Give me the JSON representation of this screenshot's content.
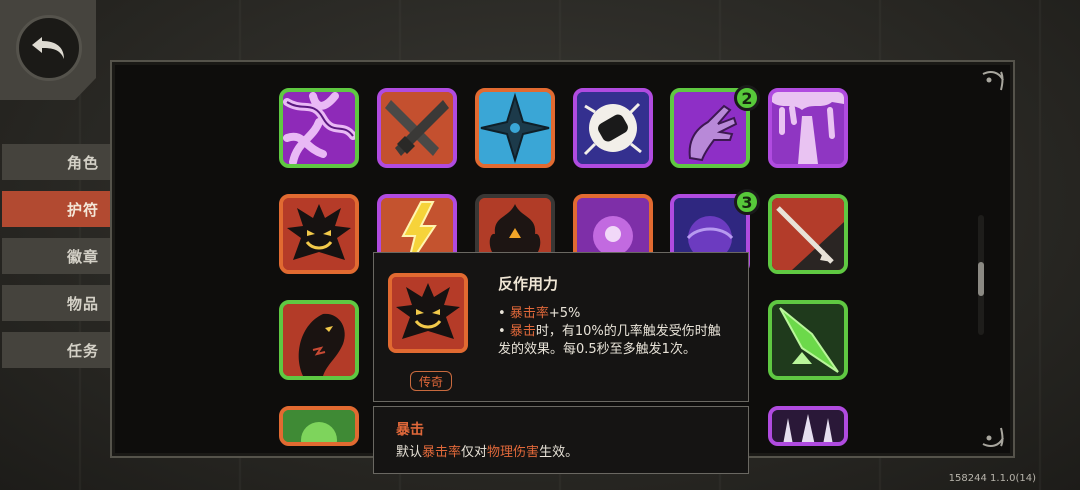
{
  "tabs": [
    {
      "label": "角色",
      "active": false
    },
    {
      "label": "护符",
      "active": true
    },
    {
      "label": "徽章",
      "active": false
    },
    {
      "label": "物品",
      "active": false
    },
    {
      "label": "任务",
      "active": false
    }
  ],
  "badges": {
    "row1": "2",
    "row2": "3"
  },
  "tooltip_main": {
    "title": "反作用力",
    "line1_prefix": "• ",
    "line1_hl": "暴击率",
    "line1_rest": "+5%",
    "line2_prefix": "• ",
    "line2_hl": "暴击",
    "line2_rest": "时，有10%的几率触发受伤时触发的效果。每0.5秒至多触发1次。",
    "rarity": "传奇"
  },
  "tooltip_sub": {
    "title": "暴击",
    "text_a": "默认",
    "text_hl1": "暴击率",
    "text_b": "仅对",
    "text_hl2": "物理伤害",
    "text_c": "生效。"
  },
  "version": "158244 1.1.0(14)",
  "colors": {
    "accent_tab": "#b24a31",
    "highlight": "#e0683a",
    "legendary": "#e16a31",
    "epic": "#b04be0",
    "rare": "#5fc842"
  }
}
